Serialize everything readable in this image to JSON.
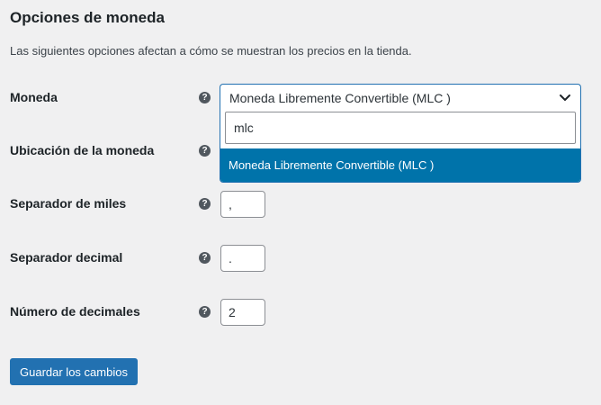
{
  "section": {
    "title": "Opciones de moneda",
    "description": "Las siguientes opciones afectan a cómo se muestran los precios en la tienda."
  },
  "fields": {
    "currency": {
      "label": "Moneda",
      "selected": "Moneda Libremente Convertible (MLC )",
      "search_value": "mlc",
      "options": [
        "Moneda Libremente Convertible (MLC )"
      ]
    },
    "position": {
      "label": "Ubicación de la moneda"
    },
    "thousand_sep": {
      "label": "Separador de miles",
      "value": ","
    },
    "decimal_sep": {
      "label": "Separador decimal",
      "value": "."
    },
    "num_decimals": {
      "label": "Número de decimales",
      "value": "2"
    }
  },
  "help_icon_glyph": "?",
  "icons": {
    "help": "help-icon",
    "dropdown": "chevron-down-icon"
  },
  "colors": {
    "accent": "#2271b1",
    "highlight": "#0073aa",
    "background": "#f0f0f1"
  },
  "save_button": {
    "label": "Guardar los cambios"
  }
}
